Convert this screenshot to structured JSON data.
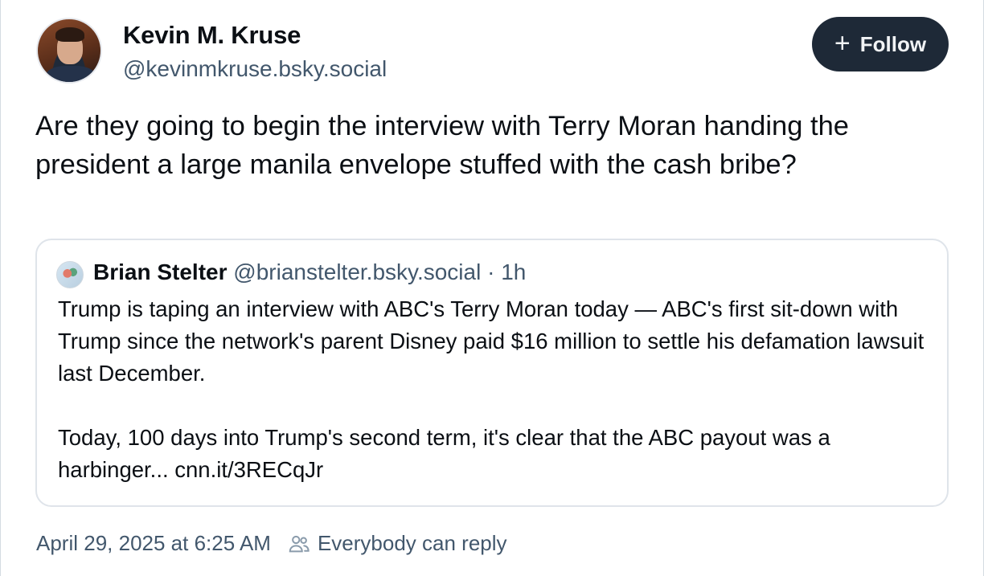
{
  "author": {
    "display_name": "Kevin M. Kruse",
    "handle": "@kevinmkruse.bsky.social"
  },
  "follow_button": {
    "icon": "plus-icon",
    "label": "Follow"
  },
  "post": {
    "text": "Are they going to begin the interview with Terry Moran handing the president a large manila envelope stuffed with the cash bribe?"
  },
  "quote": {
    "display_name": "Brian Stelter",
    "handle": "@brianstelter.bsky.social",
    "separator": "·",
    "time": "1h",
    "paragraph1": "Trump is taping an interview with ABC's Terry Moran today — ABC's first sit-down with Trump since the network's parent Disney paid $16 million to settle his defamation lawsuit last December.",
    "paragraph2": "Today, 100 days into Trump's second term, it's clear that the ABC payout was a harbinger... cnn.it/3RECqJr"
  },
  "meta": {
    "timestamp": "April 29, 2025 at 6:25 AM",
    "reply_icon": "people-icon",
    "reply_setting": "Everybody can reply"
  },
  "colors": {
    "follow_bg": "#1e2937",
    "muted_text": "#42576c",
    "border": "#dfe4ea"
  }
}
